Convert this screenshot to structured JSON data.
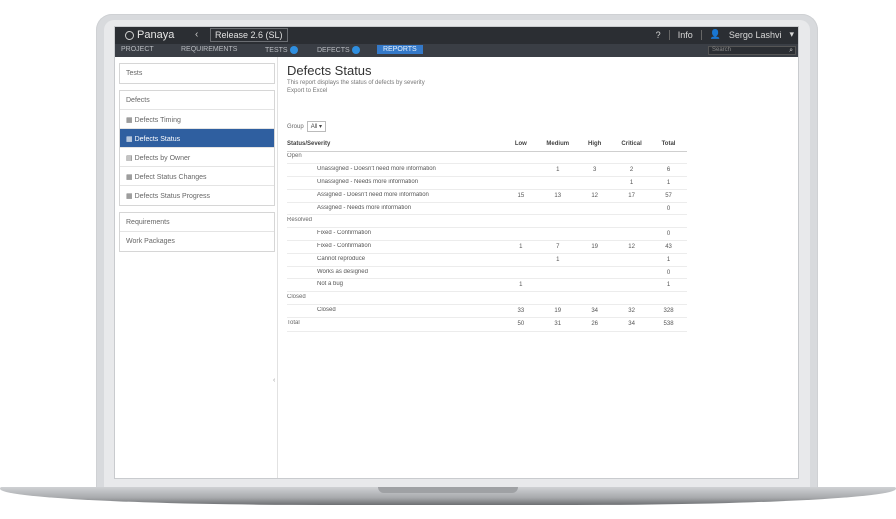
{
  "app": {
    "brand": "Panaya",
    "release_label": "Release 2.6 (SL)"
  },
  "topbar": {
    "right_items": [
      "?",
      "Info",
      "Sergo Lashvi"
    ]
  },
  "nav": {
    "tabs": [
      {
        "label": "PROJECT",
        "badge": false
      },
      {
        "label": "REQUIREMENTS",
        "badge": false
      },
      {
        "label": "TESTS",
        "badge": true
      },
      {
        "label": "DEFECTS",
        "badge": true
      },
      {
        "label": "REPORTS",
        "badge": false
      }
    ],
    "search_placeholder": "Search"
  },
  "sidebar": {
    "groups": [
      {
        "items": [
          {
            "label": "Tests",
            "active": false
          }
        ]
      },
      {
        "items": [
          {
            "label": "Defects",
            "active": false
          },
          {
            "label": "Defects Timing",
            "active": false
          },
          {
            "label": "Defects Status",
            "active": true
          },
          {
            "label": "Defects by Owner",
            "active": false
          },
          {
            "label": "Defect Status Changes",
            "active": false
          },
          {
            "label": "Defects Status Progress",
            "active": false
          }
        ]
      },
      {
        "items": [
          {
            "label": "Requirements",
            "active": false
          },
          {
            "label": "Work Packages",
            "active": false
          }
        ]
      }
    ]
  },
  "main": {
    "title": "Defects Status",
    "subtitle": "This report displays the status of defects by severity",
    "subtitle2": "Export to Excel",
    "group_label": "Group",
    "group_value": "All",
    "columns": [
      "Status/Severity",
      "Low",
      "Medium",
      "High",
      "Critical",
      "Total"
    ],
    "rows": [
      {
        "type": "cat",
        "name": "Open",
        "vals": [
          "",
          "",
          "",
          "",
          ""
        ]
      },
      {
        "type": "item",
        "name": "Unassigned - Doesn't need more information",
        "vals": [
          "",
          "1",
          "3",
          "2",
          "6"
        ]
      },
      {
        "type": "item",
        "name": "Unassigned - Needs more information",
        "vals": [
          "",
          "",
          "",
          "1",
          "1"
        ]
      },
      {
        "type": "item",
        "name": "Assigned - Doesn't need more information",
        "vals": [
          "15",
          "13",
          "12",
          "17",
          "57"
        ]
      },
      {
        "type": "item",
        "name": "Assigned - Needs more information",
        "vals": [
          "",
          "",
          "",
          "",
          "0"
        ]
      },
      {
        "type": "cat",
        "name": "Resolved",
        "vals": [
          "",
          "",
          "",
          "",
          ""
        ]
      },
      {
        "type": "item",
        "name": "Fixed - Confirmation",
        "vals": [
          "",
          "",
          "",
          "",
          "0"
        ]
      },
      {
        "type": "item",
        "name": "Fixed - Confirmation",
        "vals": [
          "1",
          "7",
          "19",
          "12",
          "43"
        ]
      },
      {
        "type": "item",
        "name": "Cannot reproduce",
        "vals": [
          "",
          "1",
          "",
          "",
          "1"
        ]
      },
      {
        "type": "item",
        "name": "Works as designed",
        "vals": [
          "",
          "",
          "",
          "",
          "0"
        ]
      },
      {
        "type": "item",
        "name": "Not a bug",
        "vals": [
          "1",
          "",
          "",
          "",
          "1"
        ]
      },
      {
        "type": "cat",
        "name": "Closed",
        "vals": [
          "",
          "",
          "",
          "",
          ""
        ]
      },
      {
        "type": "item",
        "name": "Closed",
        "vals": [
          "33",
          "19",
          "34",
          "32",
          "328"
        ]
      },
      {
        "type": "total",
        "name": "Total",
        "vals": [
          "50",
          "31",
          "26",
          "34",
          "538"
        ]
      }
    ]
  },
  "colors": {
    "topbar": "#2b2e33",
    "navbar": "#3a3e45",
    "accent": "#3479c9",
    "sidebar_active": "#2f5fa0"
  }
}
